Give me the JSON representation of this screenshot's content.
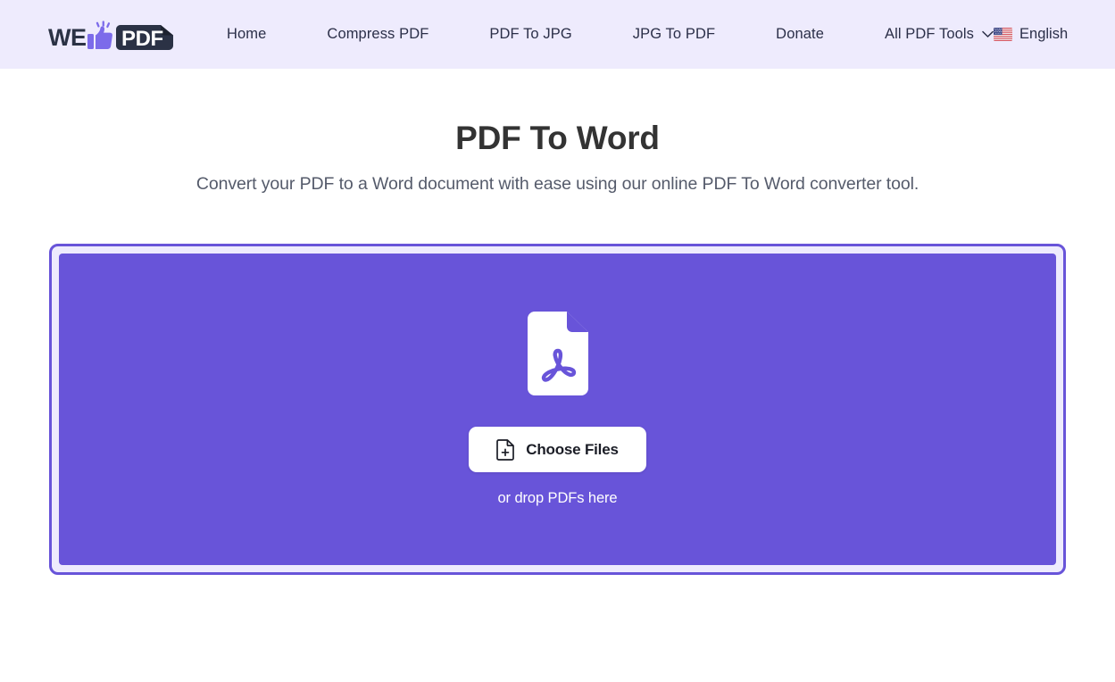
{
  "header": {
    "logo": {
      "name": "wepdf-logo",
      "text_left": "WE",
      "text_right": "PDF",
      "icon": "thumbs-up-icon",
      "color_dark": "#2b3245",
      "color_accent": "#6854d9"
    },
    "nav": [
      {
        "id": "home",
        "label": "Home"
      },
      {
        "id": "compress-pdf",
        "label": "Compress PDF"
      },
      {
        "id": "pdf-to-jpg",
        "label": "PDF To JPG"
      },
      {
        "id": "jpg-to-pdf",
        "label": "JPG To PDF"
      },
      {
        "id": "donate",
        "label": "Donate"
      },
      {
        "id": "all-pdf-tools",
        "label": "All PDF Tools",
        "icon": "chevron-down-icon",
        "has_dropdown": true
      }
    ],
    "language": {
      "label": "English",
      "flag_icon": "us-flag-icon"
    },
    "background_color": "#eeebfd",
    "text_color": "#2b2f48"
  },
  "main": {
    "title": "PDF To Word",
    "subtitle": "Convert your PDF to a Word document with ease using our online PDF To Word converter tool.",
    "title_color": "#333333",
    "subtitle_color": "#555b6b"
  },
  "dropzone": {
    "name": "pdf-dropzone",
    "file_icon": "pdf-file-icon",
    "button": {
      "label": "Choose Files",
      "icon": "file-plus-icon"
    },
    "hint": "or drop PDFs here",
    "fill_color": "#6854d9",
    "border_color": "#6854d9",
    "gap_color": "#eeebfd"
  }
}
